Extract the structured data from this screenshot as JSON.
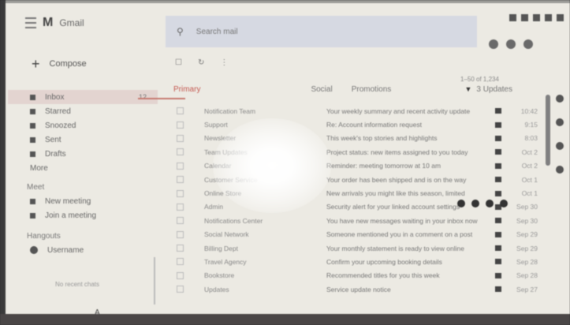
{
  "app": {
    "logo_mark": "M",
    "title": "Gmail"
  },
  "sidebar": {
    "compose_label": "Compose",
    "items": [
      {
        "label": "Inbox",
        "count": "12",
        "active": true
      },
      {
        "label": "Starred",
        "count": ""
      },
      {
        "label": "Snoozed",
        "count": ""
      },
      {
        "label": "Sent",
        "count": ""
      },
      {
        "label": "Drafts",
        "count": ""
      },
      {
        "label": "More",
        "count": ""
      }
    ],
    "meet_heading": "Meet",
    "meet_items": [
      {
        "label": "New meeting"
      },
      {
        "label": "Join a meeting"
      }
    ],
    "chat_heading": "Hangouts",
    "chat_items": [
      {
        "label": "Username"
      }
    ],
    "footer_text": "No recent chats",
    "footer_link": "A"
  },
  "search": {
    "placeholder": "Search mail"
  },
  "toolbar": {
    "select_label": "☐",
    "refresh_label": "↻",
    "more_label": "⋮"
  },
  "pager": {
    "text": "1–50 of 1,234"
  },
  "tabs": [
    {
      "label": "Primary"
    },
    {
      "label": "Social"
    },
    {
      "label": "Promotions"
    },
    {
      "label": "3 Updates"
    }
  ],
  "emails": [
    {
      "from": "Notification Team",
      "subject": "Your weekly summary and recent activity update",
      "date": "10:42"
    },
    {
      "from": "Support",
      "subject": "Re: Account information request",
      "date": "9:15"
    },
    {
      "from": "Newsletter",
      "subject": "This week's top stories and highlights",
      "date": "8:03"
    },
    {
      "from": "Team Updates",
      "subject": "Project status: new items assigned to you today",
      "date": "Oct 2"
    },
    {
      "from": "Calendar",
      "subject": "Reminder: meeting tomorrow at 10 am",
      "date": "Oct 2"
    },
    {
      "from": "Customer Service",
      "subject": "Your order has been shipped and is on the way",
      "date": "Oct 1"
    },
    {
      "from": "Online Store",
      "subject": "New arrivals you might like this season, limited",
      "date": "Oct 1"
    },
    {
      "from": "Admin",
      "subject": "Security alert for your linked account settings",
      "date": "Sep 30"
    },
    {
      "from": "Notifications Center",
      "subject": "You have new messages waiting in your inbox now",
      "date": "Sep 30"
    },
    {
      "from": "Social Network",
      "subject": "Someone mentioned you in a comment on a post",
      "date": "Sep 29"
    },
    {
      "from": "Billing Dept",
      "subject": "Your monthly statement is ready to view online",
      "date": "Sep 29"
    },
    {
      "from": "Travel Agency",
      "subject": "Confirm your upcoming booking details",
      "date": "Sep 28"
    },
    {
      "from": "Bookstore",
      "subject": "Recommended titles for you this week",
      "date": "Sep 28"
    },
    {
      "from": "Updates",
      "subject": "Service update notice",
      "date": "Sep 27"
    }
  ],
  "colors": {
    "accent": "#c45a52",
    "searchbar": "#d6d9e2",
    "background": "#eceae3"
  }
}
